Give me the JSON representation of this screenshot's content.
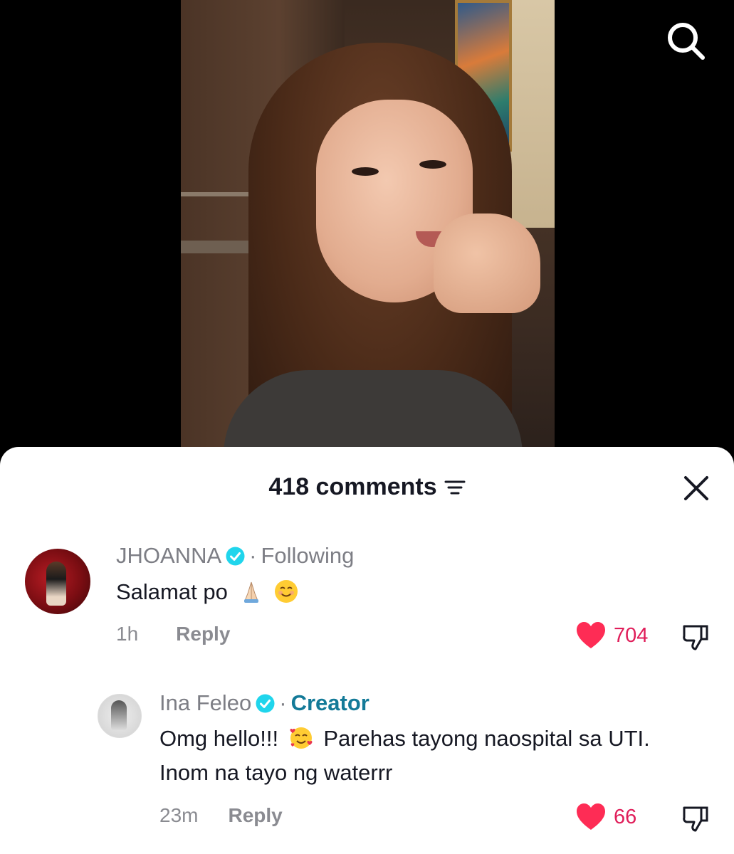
{
  "comments_header": {
    "count_label": "418 comments"
  },
  "comments": [
    {
      "username": "JHOANNA",
      "relation": "Following",
      "text_before": "Salamat po",
      "time": "1h",
      "reply_label": "Reply",
      "likes": "704"
    },
    {
      "username": "Ina Feleo",
      "relation": "Creator",
      "text_line1_before": "Omg hello!!!",
      "text_line1_after": "Parehas tayong naospital sa UTI.",
      "text_line2": "Inom na tayo ng waterrr",
      "time": "23m",
      "reply_label": "Reply",
      "likes": "66"
    }
  ],
  "colors": {
    "like": "#e01e5a",
    "verified": "#20d5ec",
    "creator": "#137a98",
    "muted": "#7d7e85"
  },
  "icons": [
    "search-icon",
    "filter-icon",
    "close-icon",
    "verified-icon",
    "heart-icon",
    "dislike-icon",
    "praying-hands-emoji",
    "smiling-emoji",
    "smiling-hearts-emoji"
  ]
}
